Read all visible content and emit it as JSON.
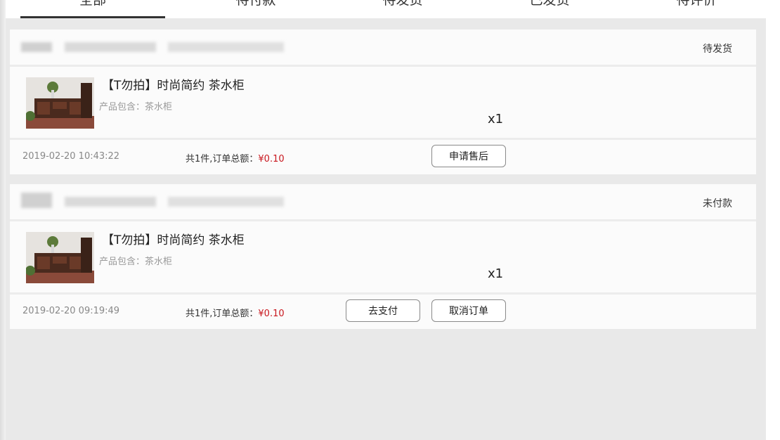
{
  "tabs": [
    {
      "label": "全部",
      "active": true
    },
    {
      "label": "待付款",
      "active": false
    },
    {
      "label": "待发货",
      "active": false
    },
    {
      "label": "已发货",
      "active": false
    },
    {
      "label": "待评价",
      "active": false
    }
  ],
  "orders": [
    {
      "status": "待发货",
      "item": {
        "title": "【T勿拍】时尚简约 茶水柜",
        "desc": "产品包含：茶水柜",
        "qty": "x1"
      },
      "date": "2019-02-20 10:43:22",
      "total_prefix": "共1件,订单总额：",
      "total_price": "¥0.10",
      "buttons": [
        "申请售后"
      ]
    },
    {
      "status": "未付款",
      "item": {
        "title": "【T勿拍】时尚简约 茶水柜",
        "desc": "产品包含：茶水柜",
        "qty": "x1"
      },
      "date": "2019-02-20 09:19:49",
      "total_prefix": "共1件,订单总额：",
      "total_price": "¥0.10",
      "buttons": [
        "去支付",
        "取消订单"
      ]
    }
  ],
  "colors": {
    "price": "#c8161d",
    "tab_underline": "#333333",
    "background": "#e9e9e9"
  },
  "icons": {
    "product_thumbnail": "furniture-cabinet-photo"
  }
}
